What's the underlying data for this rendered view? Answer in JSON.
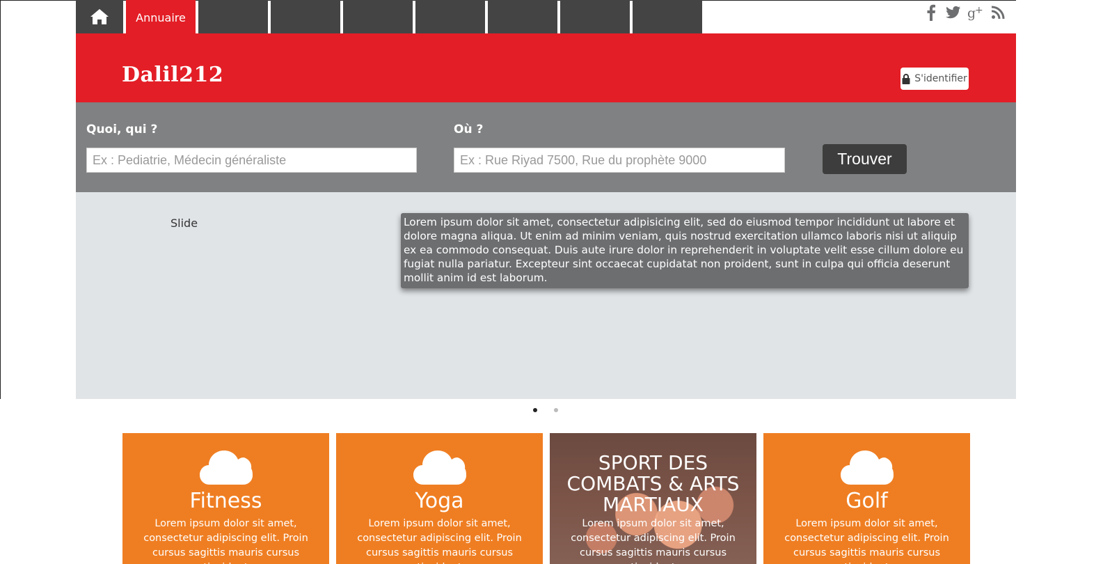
{
  "nav": {
    "home_icon": "home-icon",
    "tabs": [
      "Annuaire",
      "",
      "",
      "",
      "",
      "",
      "",
      ""
    ]
  },
  "social": [
    "facebook-icon",
    "twitter-icon",
    "google-plus-icon",
    "rss-icon"
  ],
  "header": {
    "logo": "Dalil212",
    "login_label": "S'identifier"
  },
  "search": {
    "what_label": "Quoi, qui ?",
    "what_placeholder": "Ex : Pediatrie, Médecin généraliste",
    "where_label": "Où ?",
    "where_placeholder": "Ex : Rue Riyad 7500, Rue du prophète 9000",
    "button_label": "Trouver"
  },
  "slider": {
    "slide_label": "Slide",
    "caption": "Lorem ipsum dolor sit amet, consectetur adipisicing elit, sed do eiusmod tempor incididunt ut labore et dolore magna aliqua. Ut enim ad minim veniam, quis nostrud exercitation ullamco laboris nisi ut aliquip ex ea commodo consequat. Duis aute irure dolor in reprehenderit in voluptate velit esse cillum dolore eu fugiat nulla pariatur. Excepteur sint occaecat cupidatat non proident, sunt in culpa qui officia deserunt mollit anim id est laborum.",
    "dots": 2,
    "active_dot": 0
  },
  "cards": [
    {
      "title": "Fitness",
      "text": "Lorem ipsum dolor sit amet, consectetur adipiscing elit. Proin cursus sagittis mauris cursus tincidunt"
    },
    {
      "title": "Yoga",
      "text": "Lorem ipsum dolor sit amet, consectetur adipiscing elit. Proin cursus sagittis mauris cursus tincidunt"
    },
    {
      "title": "SPORT DES COMBATS & ARTS MARTIAUX",
      "text": "Lorem ipsum dolor sit amet, consectetur adipiscing elit. Proin cursus sagittis mauris cursus tincidunt"
    },
    {
      "title": "Golf",
      "text": "Lorem ipsum dolor sit amet, consectetur adipiscing elit. Proin cursus sagittis mauris cursus tincidunt"
    }
  ],
  "colors": {
    "brand_red": "#e31e26",
    "nav_dark": "#444444",
    "search_gray": "#808182",
    "card_orange": "#ef7e22"
  }
}
